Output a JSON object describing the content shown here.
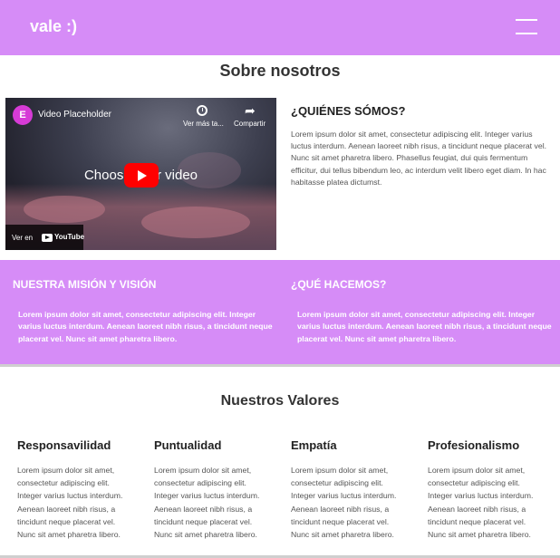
{
  "header": {
    "logo": "vale :)",
    "background": "#d68cf7"
  },
  "about": {
    "title": "Sobre nosotros"
  },
  "video": {
    "logo_letter": "E",
    "title": "Video Placeholder",
    "watch_later": "Ver más ta...",
    "share": "Compartir",
    "center_text": "Choose your video",
    "watch_on": "Ver en",
    "brand": "YouTube"
  },
  "who": {
    "title": "¿QUIÉNES SÓMOS?",
    "text": "Lorem ipsum dolor sit amet, consectetur adipiscing elit. Integer varius luctus interdum. Aenean laoreet nibh risus, a tincidunt neque placerat vel. Nunc sit amet pharetra libero. Phasellus feugiat, dui quis fermentum efficitur, dui tellus bibendum leo, ac interdum velit libero eget diam. In hac habitasse platea dictumst."
  },
  "mission": {
    "title": "NUESTRA MISIÓN Y VISIÓN",
    "text": "Lorem ipsum dolor sit amet, consectetur adipiscing elit. Integer varius luctus interdum. Aenean laoreet nibh risus, a tincidunt neque placerat vel. Nunc sit amet pharetra libero."
  },
  "what": {
    "title": "¿QUÉ HACEMOS?",
    "text": "Lorem ipsum dolor sit amet, consectetur adipiscing elit. Integer varius luctus interdum. Aenean laoreet nibh risus, a tincidunt neque placerat vel. Nunc sit amet pharetra libero."
  },
  "values": {
    "title": "Nuestros Valores",
    "items": [
      {
        "title": "Responsavilidad",
        "text": "Lorem ipsum dolor sit amet, consectetur adipiscing elit. Integer varius luctus interdum. Aenean laoreet nibh risus, a tincidunt neque placerat vel. Nunc sit amet pharetra libero."
      },
      {
        "title": "Puntualidad",
        "text": "Lorem ipsum dolor sit amet, consectetur adipiscing elit. Integer varius luctus interdum. Aenean laoreet nibh risus, a tincidunt neque placerat vel. Nunc sit amet pharetra libero."
      },
      {
        "title": "Empatía",
        "text": "Lorem ipsum dolor sit amet, consectetur adipiscing elit. Integer varius luctus interdum. Aenean laoreet nibh risus, a tincidunt neque placerat vel. Nunc sit amet pharetra libero."
      },
      {
        "title": "Profesionalismo",
        "text": "Lorem ipsum dolor sit amet, consectetur adipiscing elit. Integer varius luctus interdum. Aenean laoreet nibh risus, a tincidunt neque placerat vel. Nunc sit amet pharetra libero."
      }
    ]
  },
  "icons": {
    "menu": "hamburger-menu-icon",
    "watch_later": "clock-icon",
    "share": "share-arrow-icon",
    "play": "play-icon",
    "brand": "youtube-icon"
  }
}
